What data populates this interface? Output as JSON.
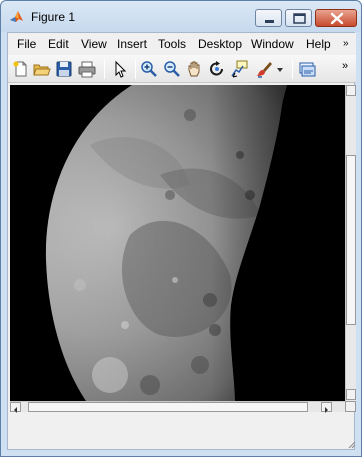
{
  "window": {
    "title": "Figure 1",
    "icon": "matlab-icon",
    "controls": [
      "minimize-icon",
      "maximize-icon",
      "close-icon"
    ]
  },
  "menu": {
    "items": [
      "File",
      "Edit",
      "View",
      "Insert",
      "Tools",
      "Desktop",
      "Window",
      "Help"
    ],
    "overflow": "»"
  },
  "toolbar": {
    "buttons": [
      "new-figure-icon",
      "open-file-icon",
      "save-icon",
      "print-icon",
      "pointer-icon",
      "zoom-in-icon",
      "zoom-out-icon",
      "pan-icon",
      "rotate-3d-icon",
      "data-cursor-icon",
      "brush-icon",
      "dropdown-icon",
      "link-plot-icon"
    ],
    "overflow": "»"
  },
  "axes": {
    "image": "moon-image",
    "colormap": "gray"
  },
  "scrollbars": {
    "vertical": "vertical-scrollbar",
    "horizontal": "horizontal-scrollbar"
  }
}
